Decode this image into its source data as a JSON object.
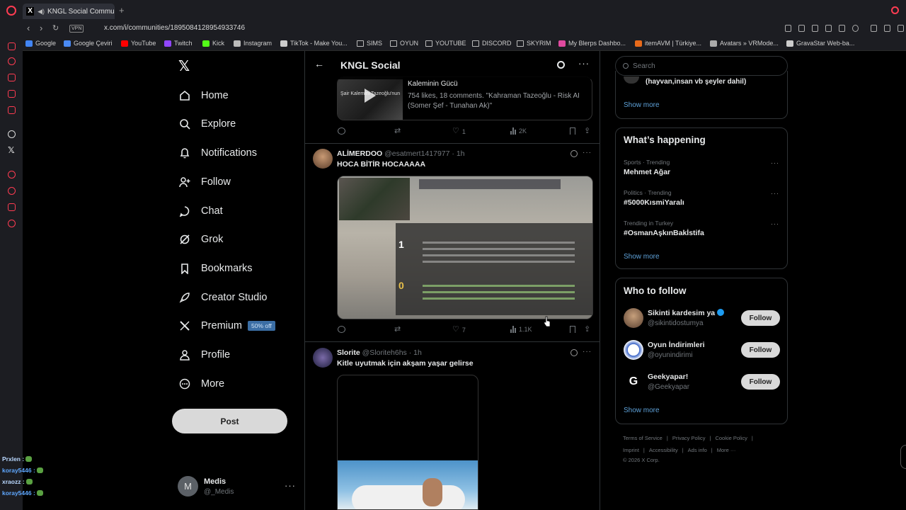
{
  "browser": {
    "tab_title": "KNGL Social Communi",
    "tab_favicon": "X",
    "url": "x.com/i/communities/1895084128954933746",
    "vpn_label": "VPN",
    "bookmarks": [
      {
        "label": "Google",
        "icon": "google-icon",
        "color": "#4285f4"
      },
      {
        "label": "Google Çeviri",
        "icon": "translate-icon",
        "color": "#4a8af4"
      },
      {
        "label": "YouTube",
        "icon": "youtube-icon",
        "color": "#ff0000"
      },
      {
        "label": "Twitch",
        "icon": "twitch-icon",
        "color": "#9146ff"
      },
      {
        "label": "Kick",
        "icon": "kick-icon",
        "color": "#53fc18"
      },
      {
        "label": "Instagram",
        "icon": "instagram-icon",
        "color": "#bbbbbb"
      },
      {
        "label": "TikTok - Make You...",
        "icon": "tiktok-icon",
        "color": "#cccccc"
      },
      {
        "label": "SIMS",
        "icon": "folder-icon",
        "color": ""
      },
      {
        "label": "OYUN",
        "icon": "folder-icon",
        "color": ""
      },
      {
        "label": "YOUTUBE",
        "icon": "folder-icon",
        "color": ""
      },
      {
        "label": "DISCORD",
        "icon": "folder-icon",
        "color": ""
      },
      {
        "label": "SKYRIM",
        "icon": "folder-icon",
        "color": ""
      },
      {
        "label": "My Blerps Dashbo...",
        "icon": "blerp-icon",
        "color": "#e04aa0"
      },
      {
        "label": "itemAVM | Türkiye...",
        "icon": "itemavm-icon",
        "color": "#e86a1a"
      },
      {
        "label": "Avatars » VRMode...",
        "icon": "vrmodel-icon",
        "color": "#aaaaaa"
      },
      {
        "label": "GravaStar Web-ba...",
        "icon": "gravastar-icon",
        "color": "#cccccc"
      }
    ]
  },
  "nav": {
    "items": [
      {
        "label": "Home",
        "icon": "home-icon"
      },
      {
        "label": "Explore",
        "icon": "search-icon"
      },
      {
        "label": "Notifications",
        "icon": "bell-icon"
      },
      {
        "label": "Follow",
        "icon": "person-add-icon"
      },
      {
        "label": "Chat",
        "icon": "chat-icon"
      },
      {
        "label": "Grok",
        "icon": "grok-icon"
      },
      {
        "label": "Bookmarks",
        "icon": "bookmark-icon"
      },
      {
        "label": "Creator Studio",
        "icon": "rocket-icon"
      },
      {
        "label": "Premium",
        "icon": "x-icon",
        "badge": "50% off"
      },
      {
        "label": "Profile",
        "icon": "person-icon"
      },
      {
        "label": "More",
        "icon": "more-circle-icon"
      }
    ],
    "post_label": "Post",
    "user": {
      "initial": "M",
      "name": "Medis",
      "handle": "@_Medis"
    }
  },
  "main": {
    "title": "KNGL Social",
    "card": {
      "thumb_caption": "Şair Kalemini Tazeoğlu'nun",
      "title": "Kaleminin Gücü",
      "description": "754 likes, 18 comments. \"Kahraman Tazeoğlu - Risk AI (Somer Şef - Tunahan Ak)\""
    },
    "tweet0_actions": {
      "replies": "",
      "reposts": "",
      "likes": "1",
      "views": "2K"
    },
    "tweets": [
      {
        "name": "ALİMERDOO",
        "handle": "@esatmert1417977",
        "time": "· 1h",
        "text": "HOCA BİTİR HOCAAAAA",
        "actions": {
          "replies": "",
          "reposts": "",
          "likes": "7",
          "views": "1.1K"
        },
        "scoreboard_scores": [
          "1",
          "0"
        ]
      },
      {
        "name": "Slorite",
        "handle": "@Sloriteh6hs",
        "time": "· 1h",
        "text": "Kitle uyutmak için akşam yaşar gelirse"
      }
    ]
  },
  "right": {
    "search_placeholder": "Search",
    "top_box_text": "(hayvan,insan vb şeyler dahil)",
    "show_more": "Show more",
    "happening_title": "What’s happening",
    "trends": [
      {
        "category": "Sports · Trending",
        "name": "Mehmet Ağar"
      },
      {
        "category": "Politics · Trending",
        "name": "#5000KısmiYaralı"
      },
      {
        "category": "Trending in Turkey",
        "name": "#OsmanAşkınBakİstifa"
      }
    ],
    "who_title": "Who to follow",
    "follow_label": "Follow",
    "suggestions": [
      {
        "name": "Sikinti kardesim ya",
        "handle": "@sikintidostumya",
        "verified": true
      },
      {
        "name": "Oyun İndirimleri",
        "handle": "@oyunindirimi",
        "verified": false
      },
      {
        "name": "Geekyapar!",
        "handle": "@Geekyapar",
        "verified": false
      }
    ],
    "footer_line1": [
      "Terms of Service",
      "|",
      "Privacy Policy",
      "|",
      "Cookie Policy",
      "|"
    ],
    "footer_line2": [
      "Imprint",
      "|",
      "Accessibility",
      "|",
      "Ads info",
      "|",
      "More ···"
    ],
    "copyright": "© 2026 X Corp."
  },
  "chat_overlay": [
    {
      "user": "Prxlen :",
      "color": "#b9d8ff"
    },
    {
      "user": "koray5446 :",
      "color": "#5fa8ff"
    },
    {
      "user": "xraozz :",
      "color": "#b9d8ff"
    },
    {
      "user": "koray5446 :",
      "color": "#5fa8ff"
    }
  ],
  "colors": {
    "accent": "#1d9bf0",
    "opera_red": "#ff3c52",
    "premium_badge": "#3b6ea5"
  }
}
